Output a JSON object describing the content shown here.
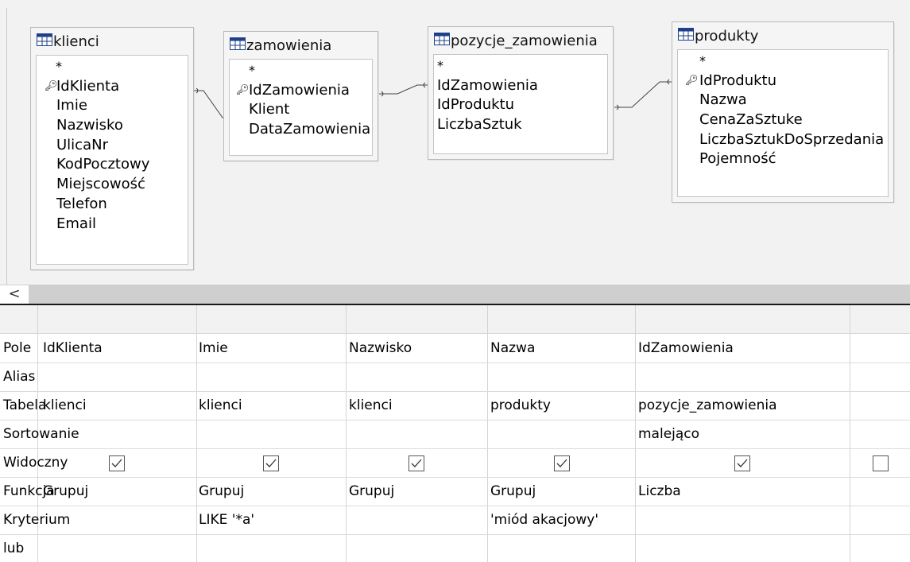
{
  "relations": {
    "klienci": {
      "title": "klienci",
      "star": "*",
      "fields": [
        "IdKlienta",
        "Imie",
        "Nazwisko",
        "UlicaNr",
        "KodPocztowy",
        "Miejscowość",
        "Telefon",
        "Email"
      ],
      "key_field": "IdKlienta"
    },
    "zamowienia": {
      "title": "zamowienia",
      "star": "*",
      "fields": [
        "IdZamowienia",
        "Klient",
        "DataZamowienia"
      ],
      "key_field": "IdZamowienia"
    },
    "pozycje_zamowienia": {
      "title": "pozycje_zamowienia",
      "star": "*",
      "fields": [
        "IdZamowienia",
        "IdProduktu",
        "LiczbaSztuk"
      ]
    },
    "produkty": {
      "title": "produkty",
      "star": "*",
      "fields": [
        "IdProduktu",
        "Nazwa",
        "CenaZaSztuke",
        "LiczbaSztukDoSprzedania",
        "Pojemność"
      ],
      "key_field": "IdProduktu"
    }
  },
  "scrollbar": {
    "left_arrow": "<"
  },
  "grid": {
    "row_labels": {
      "pole": "Pole",
      "alias": "Alias",
      "tabela": "Tabela",
      "sortowanie": "Sortowanie",
      "widoczny": "Widoczny",
      "funkcja": "Funkcja",
      "kryterium": "Kryterium",
      "lub": "lub"
    },
    "columns": [
      {
        "pole": "IdKlienta",
        "alias": "",
        "tabela": "klienci",
        "sortowanie": "",
        "widoczny": true,
        "funkcja": "Grupuj",
        "kryterium": "",
        "lub": ""
      },
      {
        "pole": "Imie",
        "alias": "",
        "tabela": "klienci",
        "sortowanie": "",
        "widoczny": true,
        "funkcja": "Grupuj",
        "kryterium": "LIKE '*a'",
        "lub": ""
      },
      {
        "pole": "Nazwisko",
        "alias": "",
        "tabela": "klienci",
        "sortowanie": "",
        "widoczny": true,
        "funkcja": "Grupuj",
        "kryterium": "",
        "lub": ""
      },
      {
        "pole": "Nazwa",
        "alias": "",
        "tabela": "produkty",
        "sortowanie": "",
        "widoczny": true,
        "funkcja": "Grupuj",
        "kryterium": "'miód akacjowy'",
        "lub": ""
      },
      {
        "pole": "IdZamowienia",
        "alias": "",
        "tabela": "pozycje_zamowienia",
        "sortowanie": "malejąco",
        "widoczny": true,
        "funkcja": "Liczba",
        "kryterium": "",
        "lub": ""
      },
      {
        "pole": "",
        "alias": "",
        "tabela": "",
        "sortowanie": "",
        "widoczny": false,
        "funkcja": "",
        "kryterium": "",
        "lub": ""
      }
    ]
  },
  "icons": {
    "table": "table-grid-icon",
    "primary_key": "key-icon",
    "checkbox_checked": "checkmark-icon"
  },
  "colors": {
    "table_icon": "#1e3f8a",
    "canvas": "#f2f2f2",
    "splitter": "#1a1a1a"
  }
}
